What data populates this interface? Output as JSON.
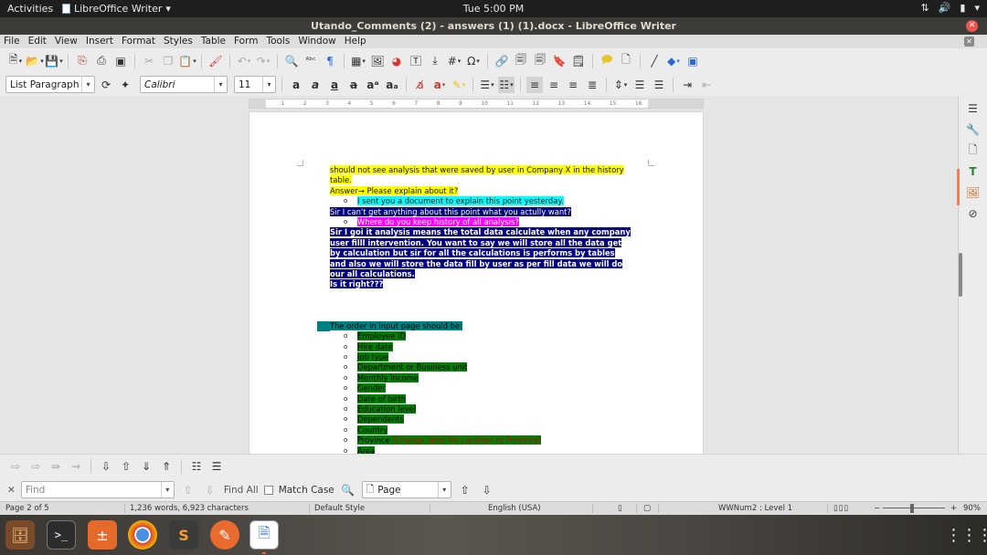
{
  "topbar": {
    "activities": "Activities",
    "app_name": "LibreOffice Writer",
    "clock": "Tue  5:00 PM"
  },
  "window": {
    "title": "Utando_Comments (2) - answers (1) (1).docx - LibreOffice Writer"
  },
  "menu": [
    "File",
    "Edit",
    "View",
    "Insert",
    "Format",
    "Styles",
    "Table",
    "Form",
    "Tools",
    "Window",
    "Help"
  ],
  "formatting": {
    "paragraph_style": "List Paragraph",
    "font_name": "Calibri",
    "font_size": "11"
  },
  "ruler_marks": [
    "1",
    "1",
    "2",
    "3",
    "4",
    "5",
    "6",
    "7",
    "8",
    "9",
    "10",
    "11",
    "12",
    "13",
    "14",
    "15",
    "16",
    "17",
    "18"
  ],
  "document": {
    "p1_line1": "should not see analysis that were saved by user in Company X in the history",
    "p1_line2": "table.",
    "answer": "Answer→ Please explain about it?",
    "bullet_marker": "o",
    "reply1": "I sent you a document to explain this point yesterday.",
    "question": "Sir I can't get anything about this point what you actully want?",
    "reply2": "Where do you keep history of all analysis?",
    "para_lines": [
      "Sir I goi it analysis means the total data calculate when any company",
      "user filll intervention. You want to say we will store all the data get",
      "by calculation but sir for all the calculations is performs by tables",
      "and also we will store the data fill by user as per fill data we will do",
      "our all calculations.",
      "Is it right???"
    ],
    "order_heading": "The order in input page should be:",
    "order_items": [
      "Employee ID",
      "Hire date",
      "Job type",
      "Department or Business unit",
      "Monthly Income",
      "Gender",
      "Date of birth",
      "Education level",
      "Dependents",
      "Country",
      "Province",
      "Area"
    ],
    "province_note": " (Change label for Location to Province)"
  },
  "findbar": {
    "placeholder": "Find",
    "find_all": "Find All",
    "match_case": "Match Case",
    "search_scope": "Page"
  },
  "status": {
    "page": "Page 2 of 5",
    "words": "1,236 words, 6,923 characters",
    "style": "Default Style",
    "language": "English (USA)",
    "list_level": "WWNum2 : Level 1",
    "zoom": "90%"
  },
  "colors": {
    "highlight_yellow": "#ffff00",
    "highlight_cyan": "#00ffff",
    "highlight_navy": "#000080",
    "highlight_magenta": "#ff00ff",
    "highlight_green": "#008000",
    "highlight_teal": "#008080",
    "accent_orange": "#e95420"
  }
}
